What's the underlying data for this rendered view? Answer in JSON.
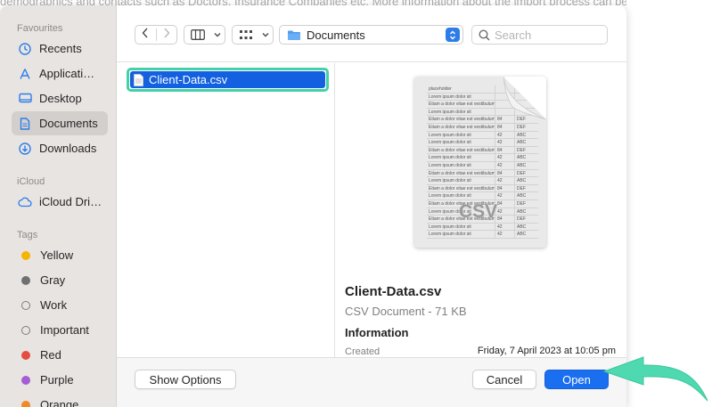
{
  "background": {
    "text": "demographics and contacts such as Doctors, Insurance Companies etc. More information about the import process can be f"
  },
  "sidebar": {
    "favourites_header": "Favourites",
    "favourites": [
      {
        "label": "Recents",
        "icon": "clock-icon"
      },
      {
        "label": "Applicati…",
        "icon": "applications-icon"
      },
      {
        "label": "Desktop",
        "icon": "desktop-icon"
      },
      {
        "label": "Documents",
        "icon": "document-icon",
        "selected": true
      },
      {
        "label": "Downloads",
        "icon": "download-icon"
      }
    ],
    "icloud_header": "iCloud",
    "icloud": [
      {
        "label": "iCloud Dri…",
        "icon": "cloud-icon"
      }
    ],
    "tags_header": "Tags",
    "tags": [
      {
        "label": "Yellow",
        "color": "#f5b400"
      },
      {
        "label": "Gray",
        "color": "#707070"
      },
      {
        "label": "Work",
        "color": "hollow"
      },
      {
        "label": "Important",
        "color": "hollow"
      },
      {
        "label": "Red",
        "color": "#e54d42"
      },
      {
        "label": "Purple",
        "color": "#a55cd5"
      },
      {
        "label": "Orange",
        "color": "#f08a24"
      }
    ]
  },
  "toolbar": {
    "location": "Documents",
    "search_placeholder": "Search"
  },
  "file_list": {
    "selected_file": "Client-Data.csv"
  },
  "preview": {
    "thumbnail_ext": "CSV",
    "thumbnail_rows": [
      [
        "placeholder",
        "",
        ""
      ],
      [
        "Lorem ipsum dolor sit",
        "",
        ""
      ],
      [
        "Etiam a dolor vitae est vestibulum",
        "",
        ""
      ],
      [
        "Lorem ipsum dolor sit",
        "",
        ""
      ],
      [
        "Etiam a dolor vitae est vestibulum",
        "84",
        "DEF"
      ],
      [
        "Etiam a dolor vitae est vestibulum",
        "84",
        "DEF"
      ],
      [
        "Lorem ipsum dolor sit",
        "42",
        "ABC"
      ],
      [
        "Lorem ipsum dolor sit",
        "42",
        "ABC"
      ],
      [
        "Etiam a dolor vitae est vestibulum",
        "84",
        "DEF"
      ],
      [
        "Lorem ipsum dolor sit",
        "42",
        "ABC"
      ],
      [
        "Lorem ipsum dolor sit",
        "42",
        "ABC"
      ],
      [
        "Etiam a dolor vitae est vestibulum",
        "84",
        "DEF"
      ],
      [
        "Lorem ipsum dolor sit",
        "42",
        "ABC"
      ],
      [
        "Etiam a dolor vitae est vestibulum",
        "84",
        "DEF"
      ],
      [
        "Lorem ipsum dolor sit",
        "42",
        "ABC"
      ],
      [
        "Etiam a dolor vitae est vestibulum",
        "84",
        "DEF"
      ],
      [
        "Lorem ipsum dolor sit",
        "42",
        "ABC"
      ],
      [
        "Etiam a dolor vitae est vestibulum",
        "84",
        "DEF"
      ],
      [
        "Lorem ipsum dolor sit",
        "42",
        "ABC"
      ],
      [
        "Lorem ipsum dolor sit",
        "42",
        "ABC"
      ]
    ],
    "file_name": "Client-Data.csv",
    "kind_size": "CSV Document - 71 KB",
    "info_header": "Information",
    "created_label": "Created",
    "created_value": "Friday, 7 April 2023 at 10:05 pm"
  },
  "footer": {
    "show_options": "Show Options",
    "cancel": "Cancel",
    "open": "Open"
  },
  "colors": {
    "accent": "#1a6ff0",
    "highlight_outline": "#44d0a8",
    "annotation_arrow": "#4fd9b0"
  }
}
